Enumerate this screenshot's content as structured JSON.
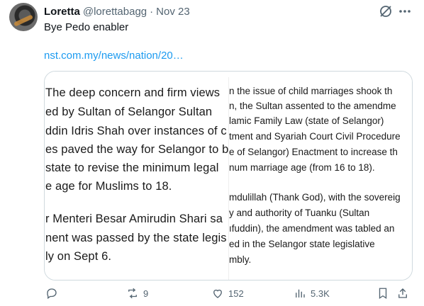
{
  "tweet": {
    "author_name": "Loretta",
    "handle": "@lorettabagg",
    "separator": "·",
    "date": "Nov 23",
    "text": "Bye Pedo enabler",
    "link": "nst.com.my/news/nation/20…"
  },
  "card": {
    "left_lines": [
      "The deep concern and firm views",
      "ed by Sultan of Selangor Sultan",
      "ddin Idris Shah over instances of c",
      "es paved the way for Selangor to b",
      "state to revise the minimum legal",
      "e age for Muslims to 18.",
      "r Menteri Besar Amirudin Shari sa",
      "nent was passed by the state legis",
      "ly on Sept 6."
    ],
    "right_lines": [
      "n the issue of child marriages shook th",
      "n, the Sultan assented to the amendme",
      "lamic Family Law (state of Selangor)",
      "tment and Syariah Court Civil Procedure",
      "e of Selangor) Enactment to increase th",
      "num marriage age (from 16 to 18).",
      "mdulillah (Thank God), with the sovereig",
      "y and authority of Tuanku (Sultan",
      "ıfuddin), the amendment was tabled an",
      "ed in the Selangor state legislative",
      "mbly."
    ]
  },
  "actions": {
    "reply_count": "",
    "repost_count": "9",
    "like_count": "152",
    "views_count": "5.3K"
  },
  "icons": [
    "avatar",
    "grok-icon",
    "more-icon",
    "reply-icon",
    "repost-icon",
    "like-icon",
    "views-icon",
    "bookmark-icon",
    "share-icon"
  ],
  "colors": {
    "link": "#1d9bf0",
    "meta": "#536471",
    "border": "#cfd9de"
  }
}
